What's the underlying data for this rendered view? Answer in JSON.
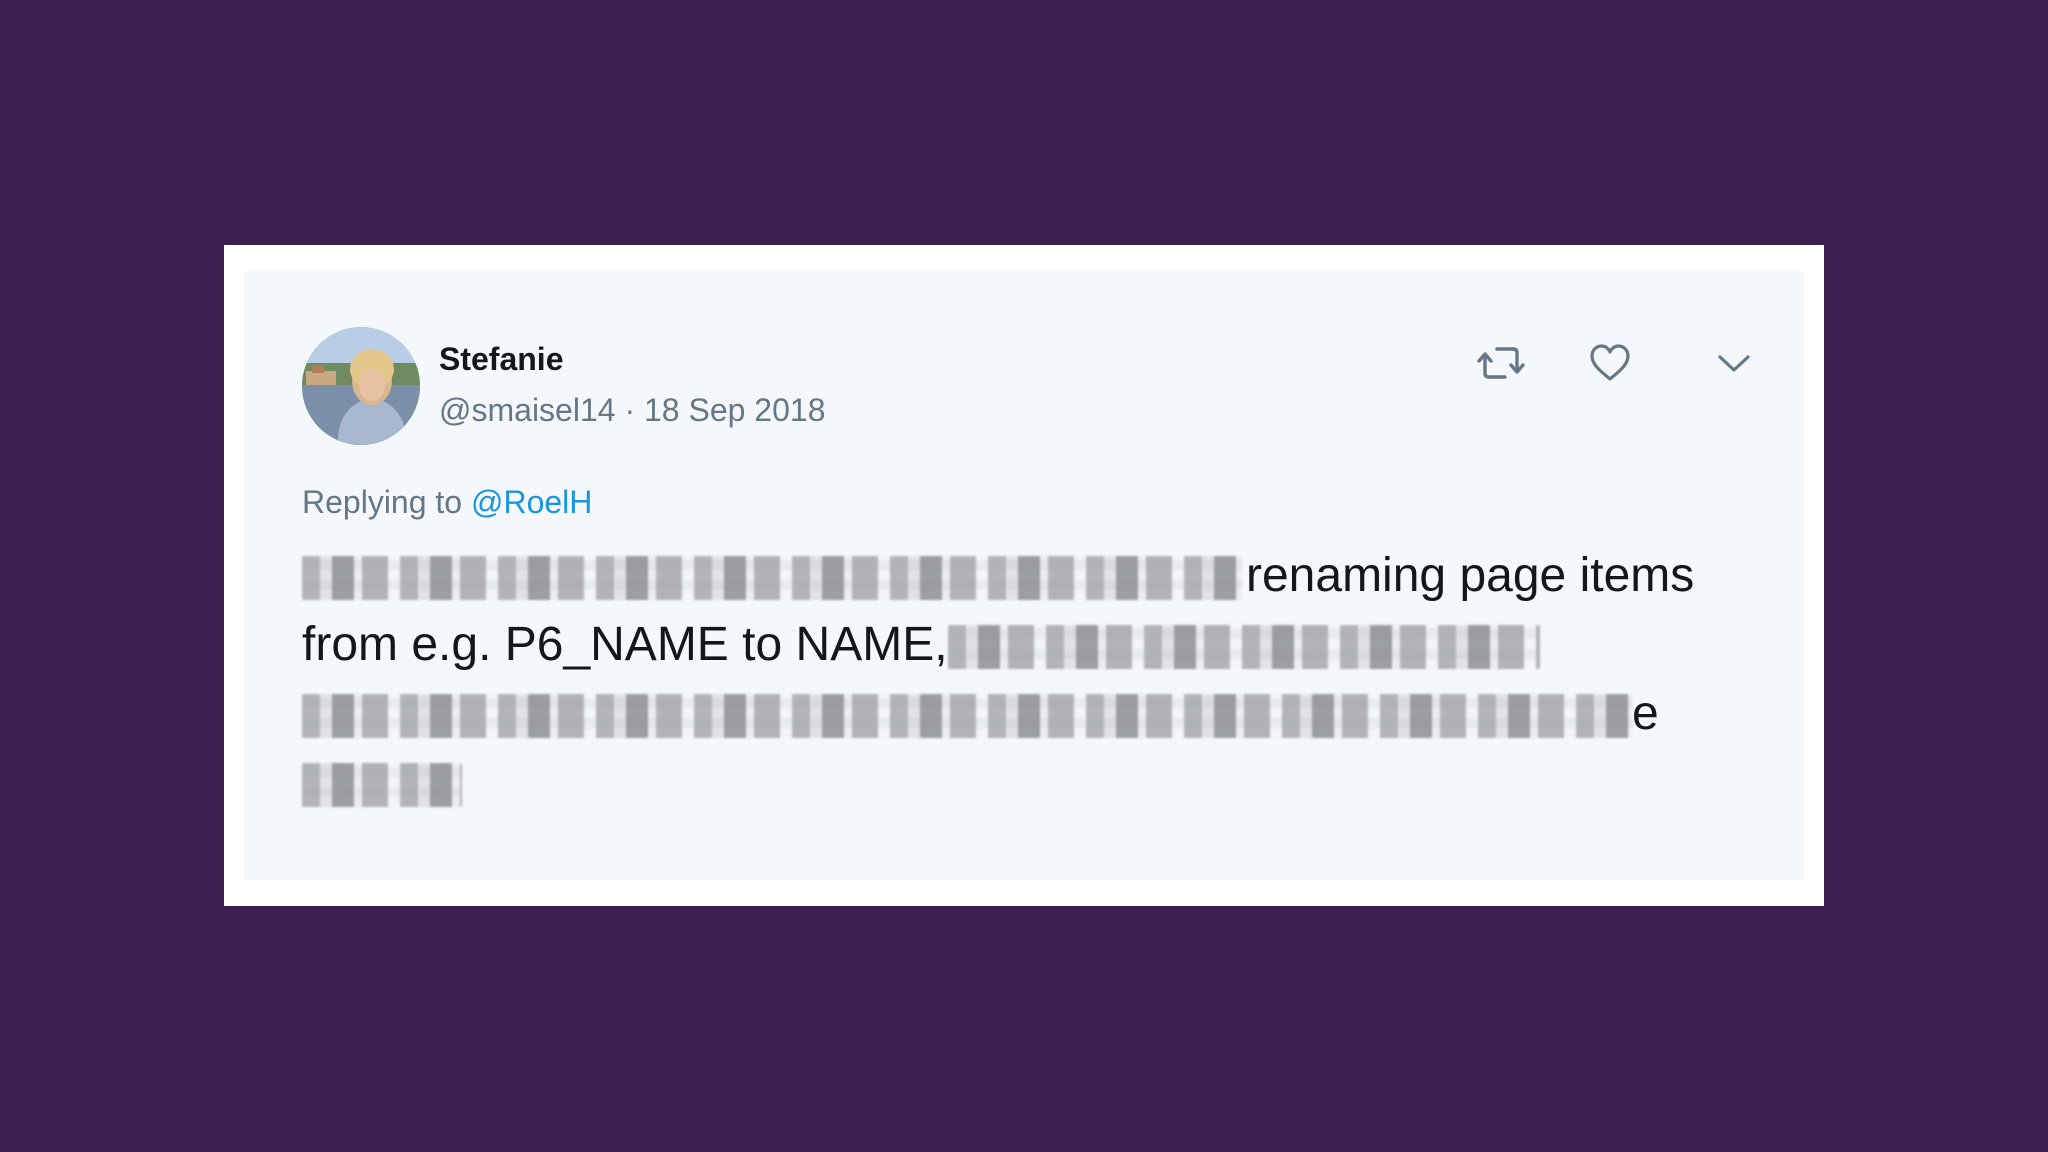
{
  "tweet": {
    "author": {
      "display_name": "Stefanie",
      "handle": "@smaisel14",
      "separator": "·",
      "date": "18 Sep 2018",
      "avatar_icon": "avatar-photo-icon"
    },
    "actions": {
      "retweet_icon": "retweet-icon",
      "like_icon": "heart-icon",
      "more_icon": "chevron-down-icon"
    },
    "reply": {
      "prefix": "Replying to",
      "mention": "@RoelH"
    },
    "text": {
      "line1_visible": "renaming page items",
      "line2_visible": "from e.g. P6_NAME to NAME,",
      "line3_tail": "e"
    }
  },
  "colors": {
    "background": "#3c1e4f",
    "card": "#f5f8fa",
    "frame": "#ffffff",
    "primary_text": "#14171a",
    "secondary_text": "#657786",
    "link": "#1b95e0"
  }
}
